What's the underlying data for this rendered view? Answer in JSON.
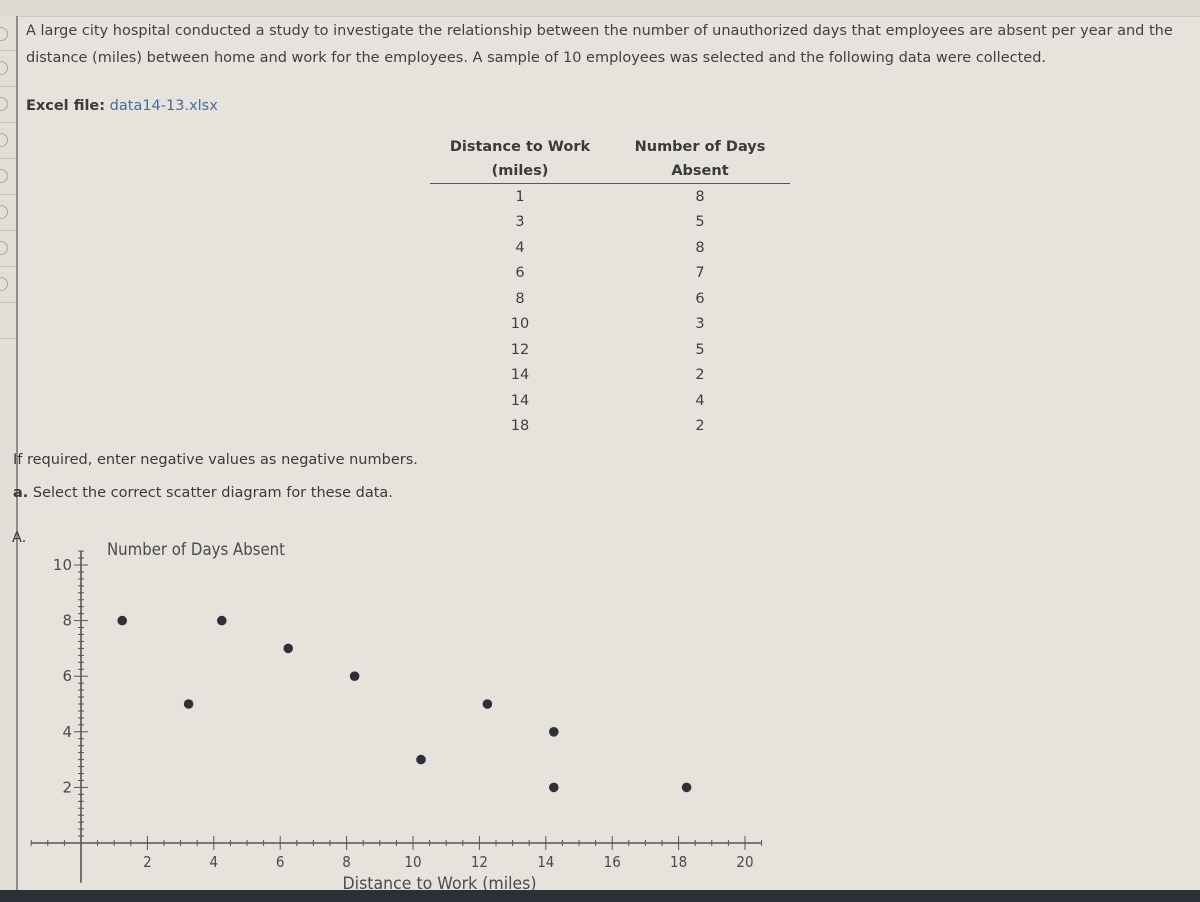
{
  "problem": {
    "intro": "A large city hospital conducted a study to investigate the relationship between the number of unauthorized days that employees are absent per year and the distance (miles) between home and work for the employees. A sample of 10 employees was selected and the following data were collected.",
    "excel_label": "Excel file:",
    "excel_file": "data14-13.xlsx"
  },
  "table": {
    "headers": [
      [
        "Distance to Work",
        "Number of Days"
      ],
      [
        "(miles)",
        "Absent"
      ]
    ],
    "rows": [
      [
        "1",
        "8"
      ],
      [
        "3",
        "5"
      ],
      [
        "4",
        "8"
      ],
      [
        "6",
        "7"
      ],
      [
        "8",
        "6"
      ],
      [
        "10",
        "3"
      ],
      [
        "12",
        "5"
      ],
      [
        "14",
        "2"
      ],
      [
        "14",
        "4"
      ],
      [
        "18",
        "2"
      ]
    ]
  },
  "instructions": {
    "note": "If required, enter negative values as negative numbers.",
    "question_prefix": "a.",
    "question": " Select the correct scatter diagram for these data."
  },
  "option": {
    "label": "A."
  },
  "chart_data": {
    "type": "scatter",
    "title": "",
    "xlabel": "Distance to Work (miles)",
    "ylabel": "Number of Days Absent",
    "xlim": [
      -1.5,
      20.5
    ],
    "ylim": [
      -1,
      10.5
    ],
    "x_ticks": [
      2,
      4,
      6,
      8,
      10,
      12,
      14,
      16,
      18,
      20
    ],
    "y_ticks": [
      2,
      4,
      6,
      8,
      10
    ],
    "grid": false,
    "points": [
      {
        "x": 1,
        "y": 8
      },
      {
        "x": 3,
        "y": 5
      },
      {
        "x": 4,
        "y": 8
      },
      {
        "x": 6,
        "y": 7
      },
      {
        "x": 8,
        "y": 6
      },
      {
        "x": 10,
        "y": 3
      },
      {
        "x": 12,
        "y": 5
      },
      {
        "x": 14,
        "y": 4
      },
      {
        "x": 14,
        "y": 2
      },
      {
        "x": 18,
        "y": 2
      }
    ]
  }
}
